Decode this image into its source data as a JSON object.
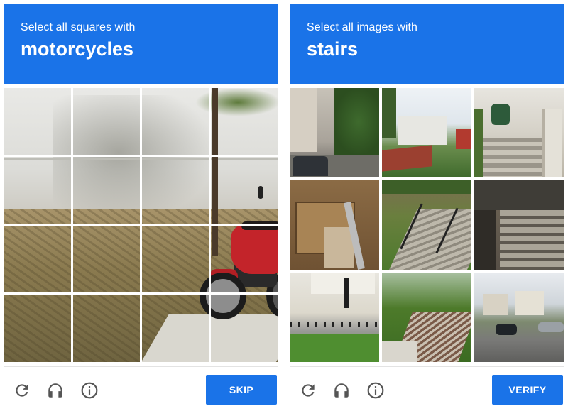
{
  "left": {
    "header": {
      "prompt": "Select all squares with",
      "target": "motorcycles"
    },
    "footer": {
      "reload_icon": "reload-icon",
      "audio_icon": "headphones-icon",
      "info_icon": "info-icon",
      "action_label": "SKIP"
    }
  },
  "right": {
    "header": {
      "prompt": "Select all images with",
      "target": "stairs"
    },
    "footer": {
      "reload_icon": "reload-icon",
      "audio_icon": "headphones-icon",
      "info_icon": "info-icon",
      "action_label": "VERIFY"
    }
  },
  "colors": {
    "accent": "#1a73e8",
    "icon": "#555555"
  }
}
